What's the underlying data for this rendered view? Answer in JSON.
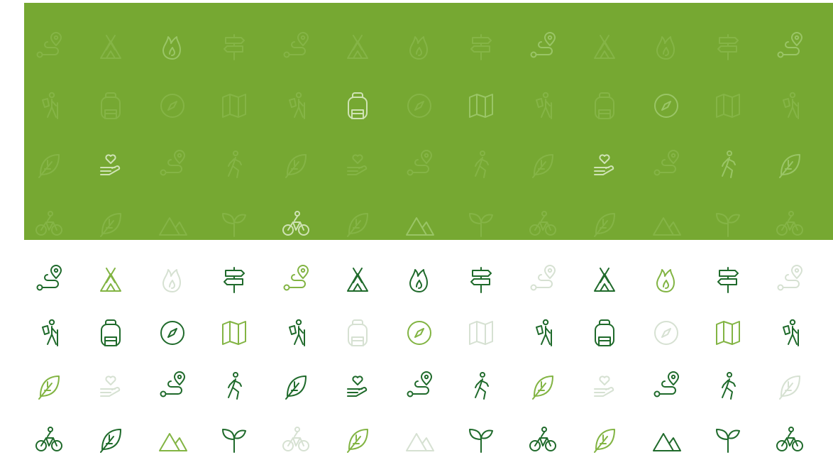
{
  "palette": {
    "panel": "#76a832",
    "dark": "#1f6a2b",
    "mid": "#82b443",
    "faint": "#d6e1d2",
    "panel_icon_faint": "#85b446",
    "panel_icon_mid": "#9ac566",
    "panel_icon_bright": "#cfe3b4"
  },
  "panel_grid": {
    "rows": [
      [
        {
          "icon": "route-icon",
          "shade": "panel_icon_faint"
        },
        {
          "icon": "tent-icon",
          "shade": "panel_icon_faint"
        },
        {
          "icon": "campfire-icon",
          "shade": "panel_icon_mid"
        },
        {
          "icon": "signpost-icon",
          "shade": "panel_icon_faint"
        },
        {
          "icon": "route-icon",
          "shade": "panel_icon_faint"
        },
        {
          "icon": "tent-icon",
          "shade": "panel_icon_faint"
        },
        {
          "icon": "campfire-icon",
          "shade": "panel_icon_faint"
        },
        {
          "icon": "signpost-icon",
          "shade": "panel_icon_faint"
        },
        {
          "icon": "route-icon",
          "shade": "panel_icon_mid"
        },
        {
          "icon": "tent-icon",
          "shade": "panel_icon_faint"
        },
        {
          "icon": "campfire-icon",
          "shade": "panel_icon_faint"
        },
        {
          "icon": "signpost-icon",
          "shade": "panel_icon_faint"
        },
        {
          "icon": "route-icon",
          "shade": "panel_icon_mid"
        }
      ],
      [
        {
          "icon": "hiker-icon",
          "shade": "panel_icon_faint"
        },
        {
          "icon": "backpack-icon",
          "shade": "panel_icon_faint"
        },
        {
          "icon": "compass-icon",
          "shade": "panel_icon_faint"
        },
        {
          "icon": "map-icon",
          "shade": "panel_icon_faint"
        },
        {
          "icon": "hiker-icon",
          "shade": "panel_icon_faint"
        },
        {
          "icon": "backpack-icon",
          "shade": "panel_icon_bright"
        },
        {
          "icon": "compass-icon",
          "shade": "panel_icon_faint"
        },
        {
          "icon": "map-icon",
          "shade": "panel_icon_mid"
        },
        {
          "icon": "hiker-icon",
          "shade": "panel_icon_faint"
        },
        {
          "icon": "backpack-icon",
          "shade": "panel_icon_faint"
        },
        {
          "icon": "compass-icon",
          "shade": "panel_icon_mid"
        },
        {
          "icon": "map-icon",
          "shade": "panel_icon_faint"
        },
        {
          "icon": "hiker-icon",
          "shade": "panel_icon_faint"
        }
      ],
      [
        {
          "icon": "leaf-icon",
          "shade": "panel_icon_faint"
        },
        {
          "icon": "heart-hand-icon",
          "shade": "panel_icon_bright"
        },
        {
          "icon": "route-icon",
          "shade": "panel_icon_faint"
        },
        {
          "icon": "walker-icon",
          "shade": "panel_icon_faint"
        },
        {
          "icon": "leaf-icon",
          "shade": "panel_icon_faint"
        },
        {
          "icon": "heart-hand-icon",
          "shade": "panel_icon_faint"
        },
        {
          "icon": "route-icon",
          "shade": "panel_icon_faint"
        },
        {
          "icon": "walker-icon",
          "shade": "panel_icon_faint"
        },
        {
          "icon": "leaf-icon",
          "shade": "panel_icon_faint"
        },
        {
          "icon": "heart-hand-icon",
          "shade": "panel_icon_bright"
        },
        {
          "icon": "route-icon",
          "shade": "panel_icon_faint"
        },
        {
          "icon": "walker-icon",
          "shade": "panel_icon_mid"
        },
        {
          "icon": "leaf-icon",
          "shade": "panel_icon_mid"
        }
      ],
      [
        {
          "icon": "bicycle-icon",
          "shade": "panel_icon_faint"
        },
        {
          "icon": "leaf-icon",
          "shade": "panel_icon_faint"
        },
        {
          "icon": "mountain-icon",
          "shade": "panel_icon_faint"
        },
        {
          "icon": "sprout-icon",
          "shade": "panel_icon_faint"
        },
        {
          "icon": "bicycle-icon",
          "shade": "panel_icon_bright"
        },
        {
          "icon": "leaf-icon",
          "shade": "panel_icon_faint"
        },
        {
          "icon": "mountain-icon",
          "shade": "panel_icon_mid"
        },
        {
          "icon": "sprout-icon",
          "shade": "panel_icon_faint"
        },
        {
          "icon": "bicycle-icon",
          "shade": "panel_icon_faint"
        },
        {
          "icon": "leaf-icon",
          "shade": "panel_icon_faint"
        },
        {
          "icon": "mountain-icon",
          "shade": "panel_icon_faint"
        },
        {
          "icon": "sprout-icon",
          "shade": "panel_icon_faint"
        },
        {
          "icon": "bicycle-icon",
          "shade": "panel_icon_faint"
        }
      ]
    ]
  },
  "white_grid": {
    "rows": [
      [
        {
          "icon": "route-icon",
          "shade": "dark"
        },
        {
          "icon": "tent-icon",
          "shade": "mid"
        },
        {
          "icon": "campfire-icon",
          "shade": "faint"
        },
        {
          "icon": "signpost-icon",
          "shade": "dark"
        },
        {
          "icon": "route-icon",
          "shade": "mid"
        },
        {
          "icon": "tent-icon",
          "shade": "dark"
        },
        {
          "icon": "campfire-icon",
          "shade": "dark"
        },
        {
          "icon": "signpost-icon",
          "shade": "dark"
        },
        {
          "icon": "route-icon",
          "shade": "faint"
        },
        {
          "icon": "tent-icon",
          "shade": "dark"
        },
        {
          "icon": "campfire-icon",
          "shade": "mid"
        },
        {
          "icon": "signpost-icon",
          "shade": "dark"
        },
        {
          "icon": "route-icon",
          "shade": "faint"
        }
      ],
      [
        {
          "icon": "hiker-icon",
          "shade": "dark"
        },
        {
          "icon": "backpack-icon",
          "shade": "dark"
        },
        {
          "icon": "compass-icon",
          "shade": "dark"
        },
        {
          "icon": "map-icon",
          "shade": "mid"
        },
        {
          "icon": "hiker-icon",
          "shade": "dark"
        },
        {
          "icon": "backpack-icon",
          "shade": "faint"
        },
        {
          "icon": "compass-icon",
          "shade": "mid"
        },
        {
          "icon": "map-icon",
          "shade": "faint"
        },
        {
          "icon": "hiker-icon",
          "shade": "dark"
        },
        {
          "icon": "backpack-icon",
          "shade": "dark"
        },
        {
          "icon": "compass-icon",
          "shade": "faint"
        },
        {
          "icon": "map-icon",
          "shade": "mid"
        },
        {
          "icon": "hiker-icon",
          "shade": "dark"
        }
      ],
      [
        {
          "icon": "leaf-icon",
          "shade": "mid"
        },
        {
          "icon": "heart-hand-icon",
          "shade": "faint"
        },
        {
          "icon": "route-icon",
          "shade": "dark"
        },
        {
          "icon": "walker-icon",
          "shade": "dark"
        },
        {
          "icon": "leaf-icon",
          "shade": "dark"
        },
        {
          "icon": "heart-hand-icon",
          "shade": "dark"
        },
        {
          "icon": "route-icon",
          "shade": "dark"
        },
        {
          "icon": "walker-icon",
          "shade": "dark"
        },
        {
          "icon": "leaf-icon",
          "shade": "mid"
        },
        {
          "icon": "heart-hand-icon",
          "shade": "faint"
        },
        {
          "icon": "route-icon",
          "shade": "dark"
        },
        {
          "icon": "walker-icon",
          "shade": "dark"
        },
        {
          "icon": "leaf-icon",
          "shade": "faint"
        }
      ],
      [
        {
          "icon": "bicycle-icon",
          "shade": "dark"
        },
        {
          "icon": "leaf-icon",
          "shade": "dark"
        },
        {
          "icon": "mountain-icon",
          "shade": "mid"
        },
        {
          "icon": "sprout-icon",
          "shade": "dark"
        },
        {
          "icon": "bicycle-icon",
          "shade": "faint"
        },
        {
          "icon": "leaf-icon",
          "shade": "mid"
        },
        {
          "icon": "mountain-icon",
          "shade": "faint"
        },
        {
          "icon": "sprout-icon",
          "shade": "dark"
        },
        {
          "icon": "bicycle-icon",
          "shade": "dark"
        },
        {
          "icon": "leaf-icon",
          "shade": "mid"
        },
        {
          "icon": "mountain-icon",
          "shade": "dark"
        },
        {
          "icon": "sprout-icon",
          "shade": "dark"
        },
        {
          "icon": "bicycle-icon",
          "shade": "dark"
        }
      ]
    ]
  }
}
